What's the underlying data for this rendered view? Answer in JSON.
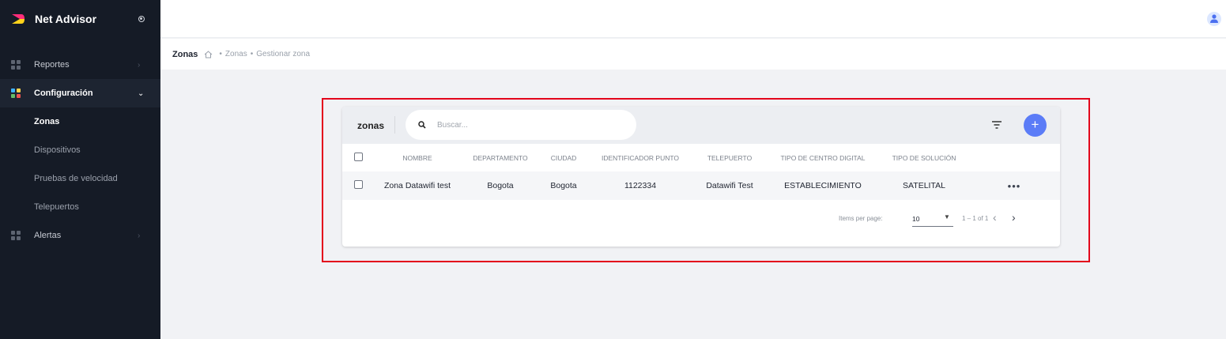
{
  "app": {
    "name": "Net Advisor"
  },
  "sidebar": {
    "items": [
      {
        "label": "Reportes"
      },
      {
        "label": "Configuración",
        "submenu": [
          {
            "label": "Zonas"
          },
          {
            "label": "Dispositivos"
          },
          {
            "label": "Pruebas de velocidad"
          },
          {
            "label": "Telepuertos"
          }
        ]
      },
      {
        "label": "Alertas"
      }
    ]
  },
  "breadcrumb": {
    "title": "Zonas",
    "path": [
      "Zonas",
      "Gestionar zona"
    ]
  },
  "card": {
    "title": "zonas",
    "search_placeholder": "Buscar...",
    "add_label": "+"
  },
  "table": {
    "headers": [
      "NOMBRE",
      "DEPARTAMENTO",
      "CIUDAD",
      "IDENTIFICADOR PUNTO",
      "TELEPUERTO",
      "TIPO DE CENTRO DIGITAL",
      "TIPO DE SOLUCIÓN"
    ],
    "rows": [
      [
        "Zona Datawifi test",
        "Bogota",
        "Bogota",
        "1122334",
        "Datawifi Test",
        "ESTABLECIMIENTO",
        "SATELITAL"
      ]
    ],
    "row_menu": "•••"
  },
  "paginator": {
    "label": "Items per page:",
    "page_size": "10",
    "range": "1 – 1 of 1"
  },
  "colors": {
    "sidebar_bg": "#151b26",
    "accent": "#5b7cf7",
    "highlight": "#e3001b"
  },
  "icons": [
    "brand-logo-icon",
    "radio-icon",
    "user-icon",
    "grid-icon",
    "chevron-right-icon",
    "chevron-down-icon",
    "home-icon",
    "search-icon",
    "filter-icon",
    "plus-icon",
    "more-icon",
    "caret-down-icon",
    "chevron-left-icon"
  ]
}
